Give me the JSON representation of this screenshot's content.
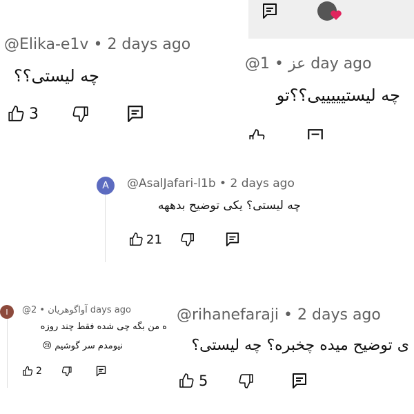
{
  "comments": [
    {
      "id": "c1",
      "author": "@Elika-e1v",
      "time": "2 days ago",
      "text": "چه لیستی؟؟",
      "likes": "3"
    },
    {
      "id": "c2",
      "author": "@عز",
      "time": "1 day ago",
      "text": "چه لیستیییییی؟؟تو",
      "likes": ""
    },
    {
      "id": "c3",
      "avatar_letter": "A",
      "avatar_color": "#5c6bc0",
      "author": "@AsalJafari-l1b",
      "time": "2 days ago",
      "text": "چه لیستی؟ یکی توضیح بدههه",
      "likes": "21"
    },
    {
      "id": "c4",
      "avatar_letter": "I",
      "avatar_color": "#8d4a3c",
      "author": "@آواگوهریان",
      "time": "2 days ago",
      "text_line1": "ه من بگه چی شده فقط چند روزه",
      "text_line2": "نیومدم سر گوشیم 😢",
      "likes": "2"
    },
    {
      "id": "c5",
      "author": "@rihanefaraji",
      "time": "2 days ago",
      "text": "ی توضیح میده چخبره؟ چه لیستی؟",
      "likes": "5"
    }
  ],
  "separator": "•",
  "colors": {
    "panel_bg": "#efefef",
    "thread_line": "#dddddd",
    "heart": "#e0245e"
  }
}
